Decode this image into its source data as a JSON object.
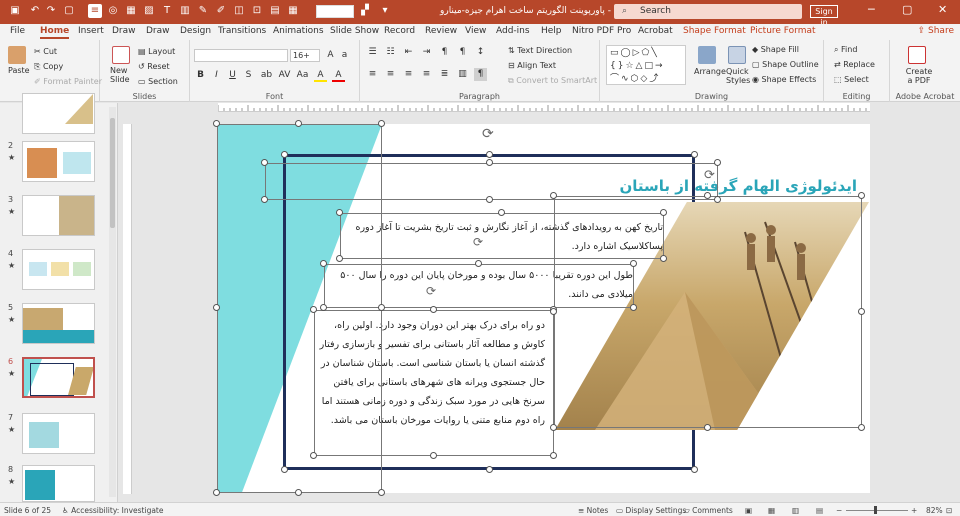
{
  "titlebar": {
    "title": "پاورپوینت الگوریتم ساخت اهرام جیزه-مینارو - PowerPoint",
    "search_placeholder": "Search",
    "signin": "Sign in",
    "font_preview": "",
    "qa_icons": [
      "save-icon",
      "undo-icon",
      "redo-icon",
      "present-icon",
      "layout-icon",
      "shape-icon",
      "table-icon",
      "picture-icon",
      "textbox-icon",
      "chart-icon",
      "smartart-icon"
    ]
  },
  "tabs": [
    "File",
    "Home",
    "Insert",
    "Draw",
    "Draw",
    "Design",
    "Transitions",
    "Animations",
    "Slide Show",
    "Record",
    "Review",
    "View",
    "Add-ins",
    "Help",
    "Nitro PDF Pro",
    "Acrobat",
    "Shape Format",
    "Picture Format"
  ],
  "share": "Share",
  "ribbon": {
    "clipboard": {
      "label": "Clipboard",
      "paste": "Paste",
      "cut": "Cut",
      "copy": "Copy",
      "format_painter": "Format Painter"
    },
    "slides": {
      "label": "Slides",
      "new_slide": "New Slide",
      "layout": "Layout",
      "reset": "Reset",
      "section": "Section"
    },
    "font": {
      "label": "Font",
      "size": "16+",
      "buttons": [
        "B",
        "I",
        "U",
        "S",
        "ab",
        "AV",
        "Aa",
        "A",
        "A"
      ]
    },
    "paragraph": {
      "label": "Paragraph",
      "text_direction": "Text Direction",
      "align_text": "Align Text",
      "convert": "Convert to SmartArt"
    },
    "drawing": {
      "label": "Drawing",
      "arrange": "Arrange",
      "quick_styles": "Quick Styles",
      "shape_fill": "Shape Fill",
      "shape_outline": "Shape Outline",
      "shape_effects": "Shape Effects"
    },
    "editing": {
      "label": "Editing",
      "find": "Find",
      "replace": "Replace",
      "select": "Select"
    },
    "acrobat": {
      "label": "Adobe Acrobat",
      "create_pdf": "Create a PDF"
    }
  },
  "thumbnails": [
    {
      "num": "",
      "star": ""
    },
    {
      "num": "2",
      "star": "★"
    },
    {
      "num": "3",
      "star": "★"
    },
    {
      "num": "4",
      "star": "★"
    },
    {
      "num": "5",
      "star": "★"
    },
    {
      "num": "6",
      "star": "★"
    },
    {
      "num": "7",
      "star": "★"
    },
    {
      "num": "8",
      "star": "★"
    }
  ],
  "slide": {
    "title": "ایدئولوژی الهام گرفته از باستان",
    "p1": "تاریخ کهن به رویدادهای گذشته، از آغاز نگارش و ثبت تاریخ بشریت تا آغاز دوره پساکلاسیک اشاره دارد.",
    "p2": "طول این دوره تقریبا ۵۰۰۰ سال بوده و مورخان پایان این دوره را سال ۵۰۰ میلادی می دانند.",
    "p3": "دو راه برای درک بهتر این دوران وجود دارد. اولین راه، کاوش و مطالعه آثار باستانی برای تفسیر و بازسازی رفتار گذشته انسان یا باستان شناسی است. باستان شناسان در حال جستجوی ویرانه های شهرهای باستانی برای یافتن سرنخ هایی در مورد سبک زندگی و دوره زمانی هستند اما راه دوم منابع متنی یا روایات مورخان باستان می باشد.",
    "accent": "#2aa5b8",
    "frame_color": "#1f2f5a"
  },
  "status": {
    "slide_info": "Slide 6 of 25",
    "accessibility": "Accessibility: Investigate",
    "notes": "Notes",
    "display_settings": "Display Settings",
    "comments": "Comments",
    "zoom": "82%"
  }
}
